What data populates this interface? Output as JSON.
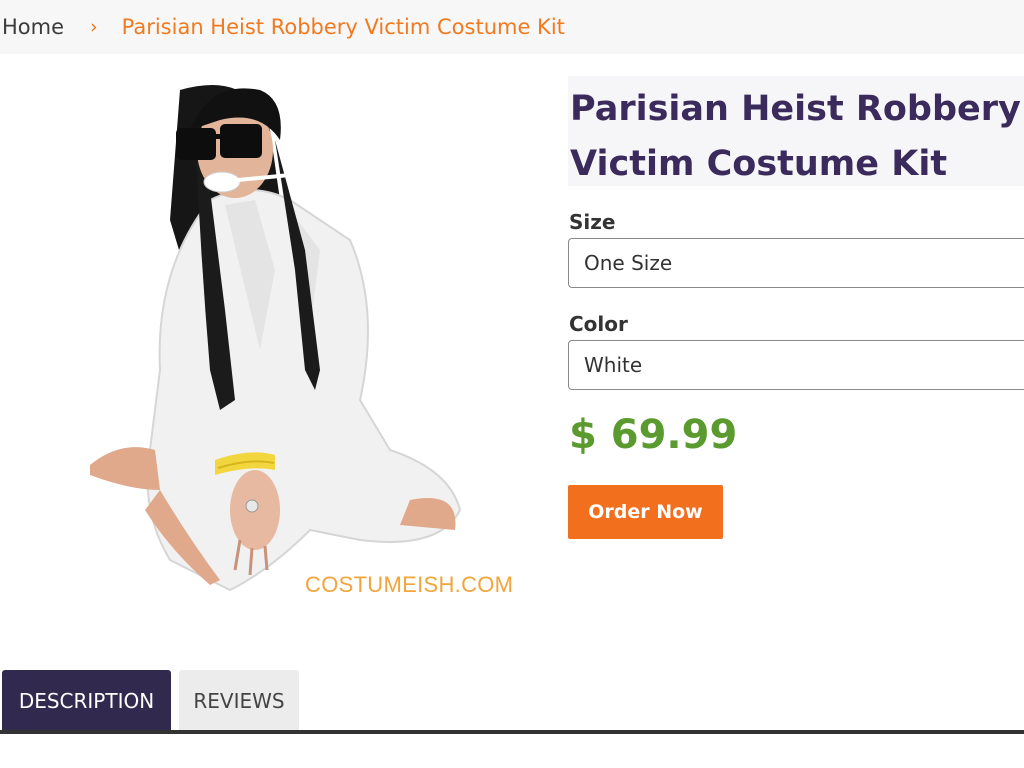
{
  "breadcrumb": {
    "home": "Home",
    "separator": "›",
    "current": "Parisian Heist Robbery Victim Costume Kit"
  },
  "product": {
    "title": "Parisian Heist Robbery Victim Costume Kit",
    "image_alt": "Woman in white robe with sunglasses, gagged, hands tied with yellow rope",
    "watermark": "COSTUMEISH.COM",
    "size_label": "Size",
    "size_value": "One Size",
    "color_label": "Color",
    "color_value": "White",
    "price": "$ 69.99",
    "order_button": "Order Now"
  },
  "tabs": [
    {
      "label": "DESCRIPTION",
      "active": true
    },
    {
      "label": "REVIEWS",
      "active": false
    }
  ],
  "colors": {
    "accent_orange": "#f26f1e",
    "title_purple": "#3a2b5c",
    "price_green": "#5a9a2f",
    "tab_active": "#32294f"
  }
}
